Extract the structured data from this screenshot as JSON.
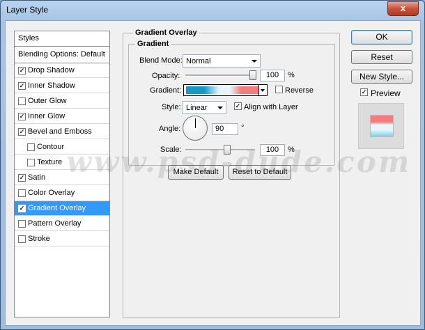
{
  "window": {
    "title": "Layer Style",
    "close_glyph": "x"
  },
  "sidebar": {
    "header": "Styles",
    "blending_options": "Blending Options: Default",
    "items": [
      {
        "label": "Drop Shadow",
        "checked": true
      },
      {
        "label": "Inner Shadow",
        "checked": true
      },
      {
        "label": "Outer Glow",
        "checked": false
      },
      {
        "label": "Inner Glow",
        "checked": true
      },
      {
        "label": "Bevel and Emboss",
        "checked": true
      },
      {
        "label": "Contour",
        "checked": false
      },
      {
        "label": "Texture",
        "checked": false
      },
      {
        "label": "Satin",
        "checked": true
      },
      {
        "label": "Color Overlay",
        "checked": false
      },
      {
        "label": "Gradient Overlay",
        "checked": true,
        "selected": true
      },
      {
        "label": "Pattern Overlay",
        "checked": false
      },
      {
        "label": "Stroke",
        "checked": false
      }
    ]
  },
  "panel": {
    "title": "Gradient Overlay",
    "group": "Gradient",
    "blend_mode": {
      "label": "Blend Mode:",
      "value": "Normal"
    },
    "opacity": {
      "label": "Opacity:",
      "value": "100",
      "unit": "%",
      "level": 100
    },
    "gradient": {
      "label": "Gradient:",
      "colors": [
        "#1899c4",
        "#e2f6fb",
        "#f37c7d"
      ]
    },
    "reverse": {
      "label": "Reverse",
      "checked": false
    },
    "style": {
      "label": "Style:",
      "value": "Linear"
    },
    "align": {
      "label": "Align with Layer",
      "checked": true
    },
    "angle": {
      "label": "Angle:",
      "value": "90",
      "unit": "°"
    },
    "scale": {
      "label": "Scale:",
      "value": "100",
      "unit": "%",
      "level": 100
    },
    "make_default": "Make Default",
    "reset_default": "Reset to Default"
  },
  "buttons": {
    "ok": "OK",
    "reset": "Reset",
    "new_style": "New Style...",
    "preview": "Preview",
    "preview_checked": true
  },
  "watermark": "www.psd-dude.com"
}
